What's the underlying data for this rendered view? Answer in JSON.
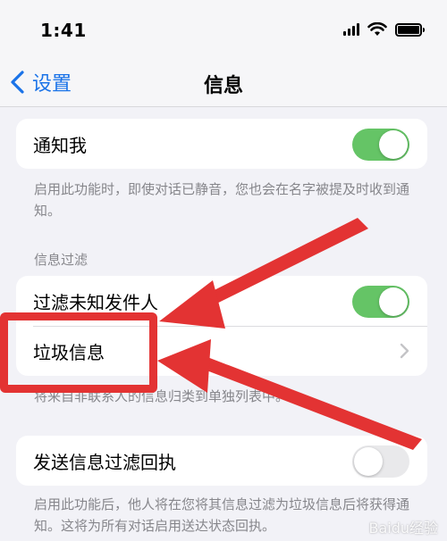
{
  "status_bar": {
    "time": "1:41"
  },
  "nav": {
    "back_label": "设置",
    "title": "信息"
  },
  "groups": {
    "notify": {
      "label": "通知我",
      "toggle_on": true
    },
    "notify_footer": "启用此功能时，即使对话已静音，您也会在名字被提及时收到通知。",
    "filter_header": "信息过滤",
    "filter_unknown": {
      "label": "过滤未知发件人",
      "toggle_on": true
    },
    "junk": {
      "label": "垃圾信息"
    },
    "filter_footer": "将来自非联系人的信息归类到单独列表中。",
    "receipts": {
      "label": "发送信息过滤回执",
      "toggle_on": false
    },
    "receipts_footer": "启用此功能后，他人将在您将其信息过滤为垃圾信息后将获得通知。这将为所有对话启用送达状态回执。"
  },
  "watermark": "Baidu经验",
  "colors": {
    "accent_blue": "#1a73e8",
    "toggle_green": "#65c466",
    "annotation_red": "#e33333",
    "background": "#f2f2f7"
  },
  "icons": [
    "wifi-icon",
    "signal-icon",
    "battery-icon",
    "back-chevron-icon",
    "chevron-right-icon"
  ]
}
